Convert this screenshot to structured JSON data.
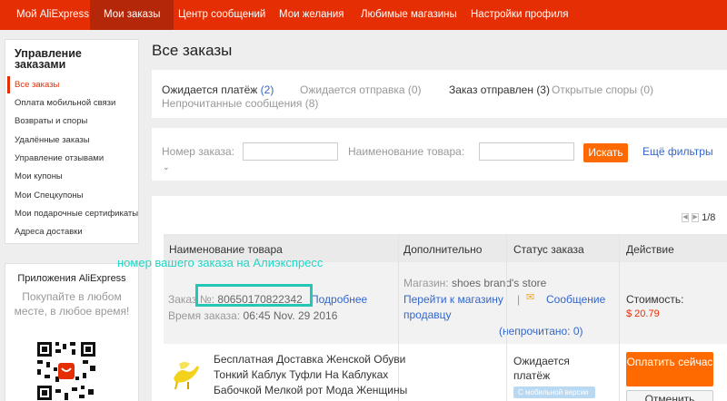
{
  "nav": {
    "items": [
      "Мой AliExpress",
      "Мои заказы",
      "Центр сообщений",
      "Мои желания",
      "Любимые магазины",
      "Настройки профиля"
    ],
    "active_index": 1
  },
  "sidebar": {
    "title": "Управление заказами",
    "items": [
      "Все заказы",
      "Оплата мобильной связи",
      "Возвраты и споры",
      "Удалённые заказы",
      "Управление отзывами",
      "Мои купоны",
      "Мои Спецкупоны",
      "Мои подарочные сертификаты",
      "Адреса доставки"
    ],
    "active_index": 0
  },
  "app_promo": {
    "title": "Приложения AliExpress",
    "description": "Покупайте в любом месте, в любое время!"
  },
  "main": {
    "title": "Все заказы",
    "tabs": [
      {
        "label": "Ожидается платёж",
        "count": "(2)"
      },
      {
        "label": "Ожидается отправка",
        "count": "(0)"
      },
      {
        "label": "Заказ отправлен",
        "count": "(3)"
      },
      {
        "label": "Открытые споры",
        "count": "(0)"
      },
      {
        "label": "Непрочитанные сообщения",
        "count": "(8)"
      }
    ],
    "active_tab": 2
  },
  "filters": {
    "order_number_label": "Номер заказа:",
    "order_number_value": "",
    "product_name_label": "Наименование товара:",
    "product_name_value": "",
    "search_button": "Искать",
    "more_filters": "Ещё фильтры"
  },
  "pager": {
    "text": "1/8"
  },
  "table": {
    "headers": [
      "Наименование товара",
      "Дополнительно",
      "Статус заказа",
      "Действие"
    ]
  },
  "order": {
    "order_label": "Заказ",
    "number_prefix": "№:",
    "number": "80650170822342",
    "details_link": "Подробнее",
    "time_label": "Время заказа:",
    "time_value": "06:45 Nov. 29 2016",
    "store_label": "Магазин:",
    "store_name": "shoes brand's store",
    "store_link_1": "Перейти к магазину",
    "store_link_2": "продавцу",
    "separator": "|",
    "message_link": "Сообщение",
    "unread_label": "(непрочитано:",
    "unread_count": "0",
    "unread_close": ")",
    "cost_label": "Стоимость:",
    "cost_value": "$ 20.79",
    "product_title": "Бесплатная Доставка Женской Обуви Тонкий Каблук Туфли На Каблуках Бабочкой Мелкой рот Мода Женщины Насосы Заостренные",
    "status": "Ожидается платёж",
    "mobile_badge": "С мобильной версии",
    "pay_button": "Оплатить сейчас",
    "cancel_button": "Отменить"
  },
  "annotation": {
    "text": "номер вашего заказа на Алиэкспресс",
    "color": "#21d6c5"
  },
  "colors": {
    "brand": "#e62e04",
    "accent": "#ff6a00",
    "link": "#3366cc"
  }
}
